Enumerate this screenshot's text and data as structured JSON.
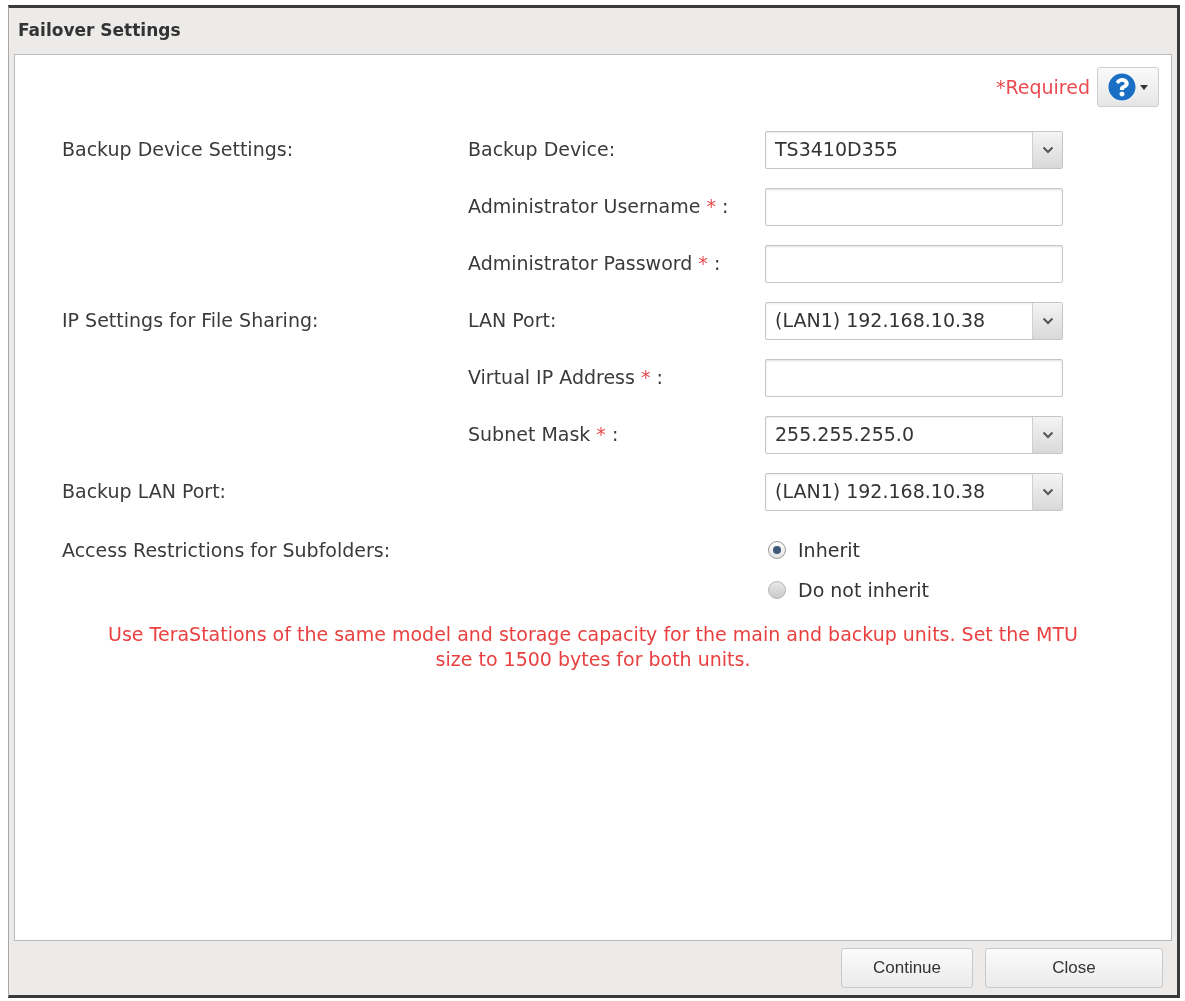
{
  "window": {
    "title": "Failover Settings"
  },
  "header": {
    "required_note": "*Required"
  },
  "sections": [
    {
      "label": "Backup Device Settings:",
      "fields": [
        {
          "kind": "select",
          "label": "Backup Device:",
          "value": "TS3410D355"
        },
        {
          "kind": "text",
          "label": "Administrator Username",
          "marker": "*",
          "suffix": ":"
        },
        {
          "kind": "text",
          "label": "Administrator Password",
          "marker": "*",
          "suffix": ":"
        }
      ]
    },
    {
      "label": "IP Settings for File Sharing:",
      "fields": [
        {
          "kind": "select",
          "label": "LAN Port:",
          "value": "(LAN1) 192.168.10.38"
        },
        {
          "kind": "text",
          "label": "Virtual IP Address",
          "marker": "*",
          "suffix": ":"
        },
        {
          "kind": "select",
          "label": "Subnet Mask",
          "marker": "*",
          "suffix": ":",
          "value": "255.255.255.0"
        }
      ]
    },
    {
      "label": "Backup LAN Port:",
      "fields": [
        {
          "kind": "select",
          "value": "(LAN1) 192.168.10.38"
        }
      ]
    },
    {
      "label": "Access Restrictions for Subfolders:",
      "fields": [
        {
          "kind": "radio",
          "options": [
            {
              "label": "Inherit",
              "selected": true
            },
            {
              "label": "Do not inherit",
              "selected": false
            }
          ]
        }
      ]
    }
  ],
  "note": "Use TeraStations of the same model and storage capacity for the main and backup units. Set the MTU size to 1500 bytes for both units.",
  "buttons": [
    {
      "label": "Continue"
    },
    {
      "label": "Close"
    }
  ]
}
